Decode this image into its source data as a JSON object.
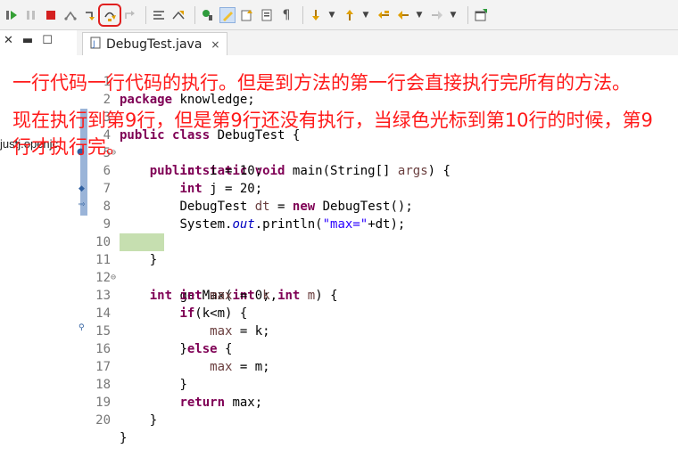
{
  "toolbar": {
    "icons": [
      "resume-icon",
      "suspend-icon",
      "terminate-icon",
      "disconnect-icon",
      "step-into-icon",
      "step-over-icon",
      "step-return-icon",
      "drop-to-frame-icon",
      "use-step-filters-icon",
      "debug-pin-icon",
      "highlighter-icon",
      "open-type-icon",
      "outline-icon",
      "show-whitespace-icon",
      "next-annotation-icon",
      "previous-annotation-icon",
      "back-icon",
      "forward-icon",
      "new-window-icon"
    ]
  },
  "leftpanel": {
    "visible_text": "justj.openjc"
  },
  "tab": {
    "label": "DebugTest.java",
    "close": "×"
  },
  "annotation": {
    "para1": "一行代码一行代码的执行。但是到方法的第一行会直接执行完所有的方法。",
    "para2": "现在执行到第9行，但是第9行还没有执行，当绿色光标到第10行的时候，第9行才执行完。"
  },
  "code": {
    "lines": [
      {
        "n": "1",
        "fold": ""
      },
      {
        "n": "2",
        "fold": ""
      },
      {
        "n": "3",
        "fold": ""
      },
      {
        "n": "4",
        "fold": "⊖"
      },
      {
        "n": "5",
        "fold": ""
      },
      {
        "n": "6",
        "fold": ""
      },
      {
        "n": "7",
        "fold": ""
      },
      {
        "n": "8",
        "fold": ""
      },
      {
        "n": "9",
        "fold": ""
      },
      {
        "n": "10",
        "fold": ""
      },
      {
        "n": "11",
        "fold": "⊖"
      },
      {
        "n": "12",
        "fold": ""
      },
      {
        "n": "13",
        "fold": ""
      },
      {
        "n": "14",
        "fold": ""
      },
      {
        "n": "15",
        "fold": ""
      },
      {
        "n": "16",
        "fold": ""
      },
      {
        "n": "17",
        "fold": ""
      },
      {
        "n": "18",
        "fold": ""
      },
      {
        "n": "19",
        "fold": ""
      },
      {
        "n": "20",
        "fold": ""
      }
    ],
    "t": {
      "package": "package",
      "pkg_name": " knowledge;",
      "public": "public",
      "class": "class",
      "classname": " DebugTest {",
      "static": "static",
      "void": "void",
      "main_sig": " main(String[] ",
      "args": "args",
      "brace_open": ") {",
      "int": "int",
      "i_part": " i = 10;",
      "j_part": " j = 20;",
      "dt_decl_a": "DebugTest ",
      "dt": "dt",
      "dt_decl_b": " = ",
      "new": "new",
      "dt_decl_c": " DebugTest();",
      "sys": "System.",
      "out": "out",
      "println_a": ".println(",
      "str_max": "\"max=\"",
      "println_b": "+dt);",
      "close_brace": "}",
      "getmax_a": " getMax(",
      "k": "k",
      "comma": ",",
      "m": "m",
      "getmax_b": ") {",
      "max": "max",
      "assign0": " = 0;",
      "if": "if",
      "if_cond": "(k<m) {",
      "assign_k": " = k;",
      "else_a": "}",
      "else": "else",
      "else_b": " {",
      "assign_m": " = m;",
      "return": "return",
      "ret_val": " max;"
    }
  }
}
